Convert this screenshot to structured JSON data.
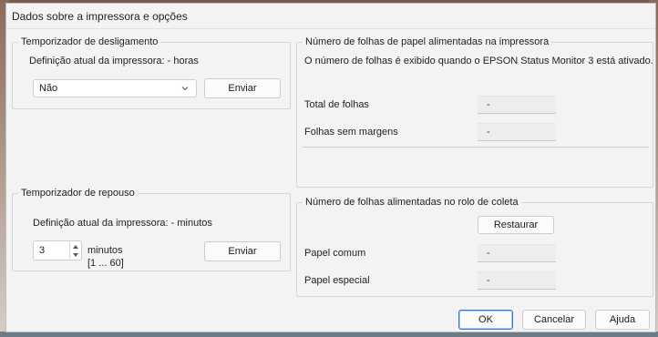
{
  "dialog": {
    "title": "Dados sobre a impressora e opções"
  },
  "shutdown_timer": {
    "group_title": "Temporizador de desligamento",
    "current_setting_label": "Definição atual da impressora: - horas",
    "selected_value": "Não",
    "send_label": "Enviar"
  },
  "sleep_timer": {
    "group_title": "Temporizador de repouso",
    "current_setting_label": "Definição atual da impressora: - minutos",
    "value": "3",
    "unit_label": "minutos",
    "range_label": "[1 ... 60]",
    "send_label": "Enviar"
  },
  "sheets_fed": {
    "group_title": "Número de folhas de papel alimentadas na impressora",
    "info_text": "O número de folhas é exibido quando o EPSON Status Monitor 3 está ativado.",
    "rows": [
      {
        "label": "Total de folhas",
        "value": "-"
      },
      {
        "label": "Folhas sem margens",
        "value": "-"
      }
    ]
  },
  "pickup_roller": {
    "group_title": "Número de folhas alimentadas no rolo de coleta",
    "reset_label": "Restaurar",
    "rows": [
      {
        "label": "Papel comum",
        "value": "-"
      },
      {
        "label": "Papel especial",
        "value": "-"
      }
    ]
  },
  "footer": {
    "ok_label": "OK",
    "cancel_label": "Cancelar",
    "help_label": "Ajuda"
  },
  "icons": {
    "dropdown": "chevron-down-icon",
    "spin_up": "spin-up-icon",
    "spin_down": "spin-down-icon"
  }
}
